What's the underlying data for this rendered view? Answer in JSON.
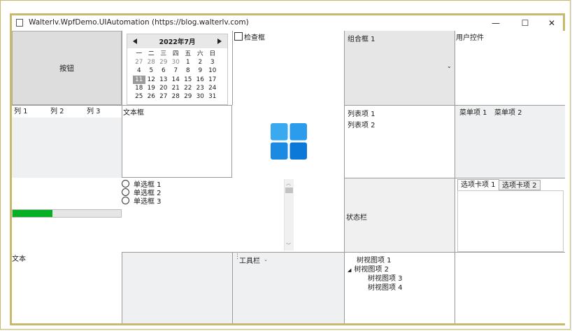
{
  "window": {
    "title": "Walterlv.WpfDemo.UIAutomation (https://blog.walterlv.com)",
    "controls": {
      "minimize": "—",
      "maximize": "☐",
      "close": "✕"
    }
  },
  "button": {
    "label": "按钮"
  },
  "calendar": {
    "month_label": "2022年7月",
    "weekdays": [
      "一",
      "二",
      "三",
      "四",
      "五",
      "六",
      "日"
    ],
    "rows": [
      [
        "27",
        "28",
        "29",
        "30",
        "1",
        "2",
        "3"
      ],
      [
        "4",
        "5",
        "6",
        "7",
        "8",
        "9",
        "10"
      ],
      [
        "11",
        "12",
        "13",
        "14",
        "15",
        "16",
        "17"
      ],
      [
        "18",
        "19",
        "20",
        "21",
        "22",
        "23",
        "24"
      ],
      [
        "25",
        "26",
        "27",
        "28",
        "29",
        "30",
        "31"
      ]
    ],
    "selected": "11"
  },
  "checkbox": {
    "label": "检查框"
  },
  "combobox": {
    "label": "组合框 1"
  },
  "usercontrol": {
    "label": "用户控件"
  },
  "listview": {
    "columns": [
      "列 1",
      "列 2",
      "列 3"
    ]
  },
  "textbox": {
    "label": "文本框"
  },
  "listbox": {
    "items": [
      "列表项 1",
      "列表项 2"
    ]
  },
  "menu": {
    "items": [
      "菜单项 1",
      "菜单项 2"
    ]
  },
  "radios": {
    "items": [
      "单选框 1",
      "单选框 2",
      "单选框 3"
    ]
  },
  "progressbar": {
    "value_fraction": 0.37,
    "color": "#06b025"
  },
  "statusbar": {
    "label": "状态栏"
  },
  "tabs": {
    "items": [
      "选项卡项 1",
      "选项卡项 2"
    ]
  },
  "textblock": {
    "label": "文本"
  },
  "toolbar": {
    "label": "工具栏"
  },
  "treeview": {
    "items": [
      "树视图项 1",
      "树视图项 2",
      "树视图项 3",
      "树视图项 4"
    ]
  },
  "logo": {
    "color": "#1a8fe3"
  }
}
